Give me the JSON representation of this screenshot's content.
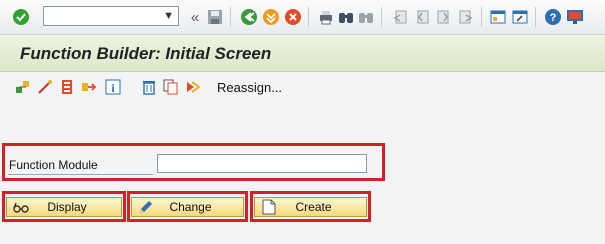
{
  "system_toolbar": {
    "command_field_value": "",
    "icons": [
      "enter-checkmark-icon",
      "back-double-chevron-icon",
      "save-icon",
      "back-icon",
      "exit-icon",
      "cancel-icon",
      "print-icon",
      "find-icon",
      "find-next-icon",
      "first-page-icon",
      "previous-page-icon",
      "next-page-icon",
      "last-page-icon",
      "create-session-icon",
      "shortcut-icon",
      "help-icon",
      "customize-layout-icon"
    ]
  },
  "title_bar": {
    "title": "Function Builder: Initial Screen"
  },
  "app_toolbar": {
    "icons": [
      "other-object-icon",
      "wizard-icon",
      "test-execute-icon",
      "where-used-icon",
      "info-icon",
      "delete-icon",
      "copy-icon",
      "rename-icon"
    ],
    "reassign_label": "Reassign..."
  },
  "form": {
    "function_module_label": "Function Module",
    "function_module_value": ""
  },
  "buttons": {
    "display_label": "Display",
    "change_label": "Change",
    "create_label": "Create"
  },
  "colors": {
    "highlight_red": "#d81f26",
    "title_bg": "#dbe7c8",
    "button_bg": "#f4d97b"
  }
}
